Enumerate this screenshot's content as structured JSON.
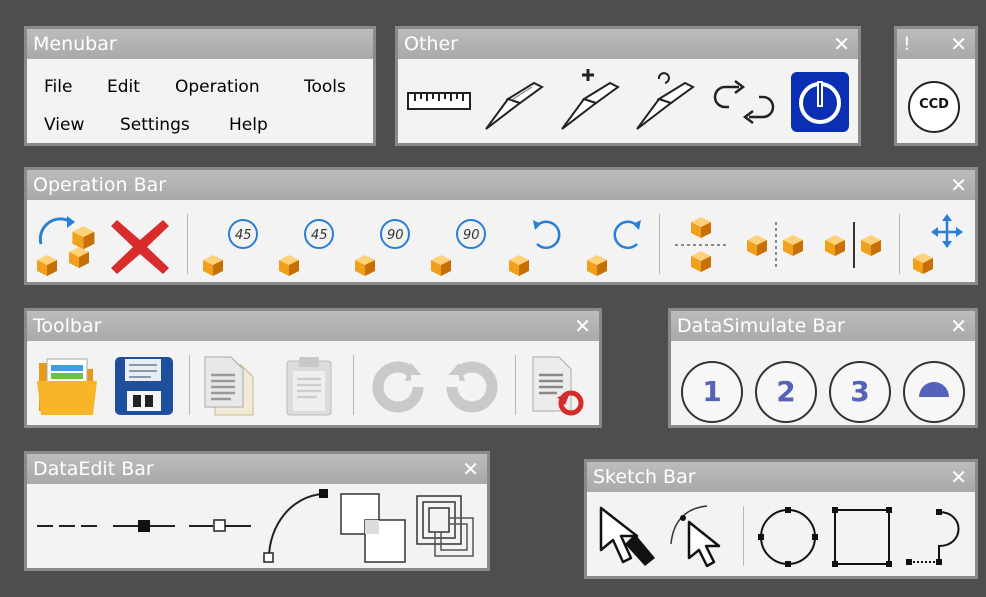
{
  "menubar": {
    "title": "Menubar",
    "row1": [
      "File",
      "Edit",
      "Operation",
      "Tools"
    ],
    "row2": [
      "View",
      "Settings",
      "Help"
    ]
  },
  "other": {
    "title": "Other",
    "close": "✕"
  },
  "ccd_panel": {
    "title": "!",
    "close": "✕",
    "button_label": "CCD"
  },
  "operation_bar": {
    "title": "Operation Bar",
    "close": "✕",
    "rotation_labels": [
      "45",
      "45",
      "90",
      "90"
    ]
  },
  "toolbar": {
    "title": "Toolbar",
    "close": "✕"
  },
  "datasimulate_bar": {
    "title": "DataSimulate Bar",
    "close": "✕",
    "buttons": [
      "1",
      "2",
      "3"
    ]
  },
  "dataedit_bar": {
    "title": "DataEdit Bar",
    "close": "✕"
  },
  "sketch_bar": {
    "title": "Sketch Bar",
    "close": "✕"
  },
  "colors": {
    "background": "#4e4e4e",
    "titlebar": "#b0b0b0",
    "panel": "#f3f3f3",
    "cube_orange": "#f29a12",
    "rotate_blue": "#2a7ed8",
    "delete_red": "#d82b2b"
  }
}
